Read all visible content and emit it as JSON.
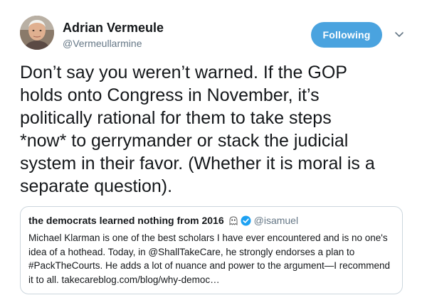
{
  "tweet": {
    "author": {
      "name": "Adrian Vermeule",
      "handle": "@Vermeullarmine"
    },
    "follow_button": "Following",
    "text": "Don’t say you weren’t warned. If the GOP\nholds onto Congress in November, it’s\npolitically rational for them to take steps\n*now* to gerrymander or stack the judicial\nsystem in their favor. (Whether it is moral is a\nseparate question).",
    "quoted": {
      "name": "the democrats learned nothing from 2016",
      "handle": "@isamuel",
      "verified": true,
      "text": "Michael Klarman is one of the best scholars I have ever encountered and is no one's\nidea of a hothead. Today, in @ShallTakeCare, he strongly endorses a plan to\n#PackTheCourts. He adds a lot of nuance and power to the argument—I recommend\nit to all. takecareblog.com/blog/why-democ…"
    }
  },
  "icons": {
    "menu": "chevron-down-icon",
    "verified": "verified-badge-icon",
    "emoji": "ghost-emoji-icon"
  },
  "colors": {
    "follow_button": "#4aa3df",
    "secondary_text": "#657786",
    "verified": "#1da1f2",
    "card_border": "#ccd6dd"
  }
}
